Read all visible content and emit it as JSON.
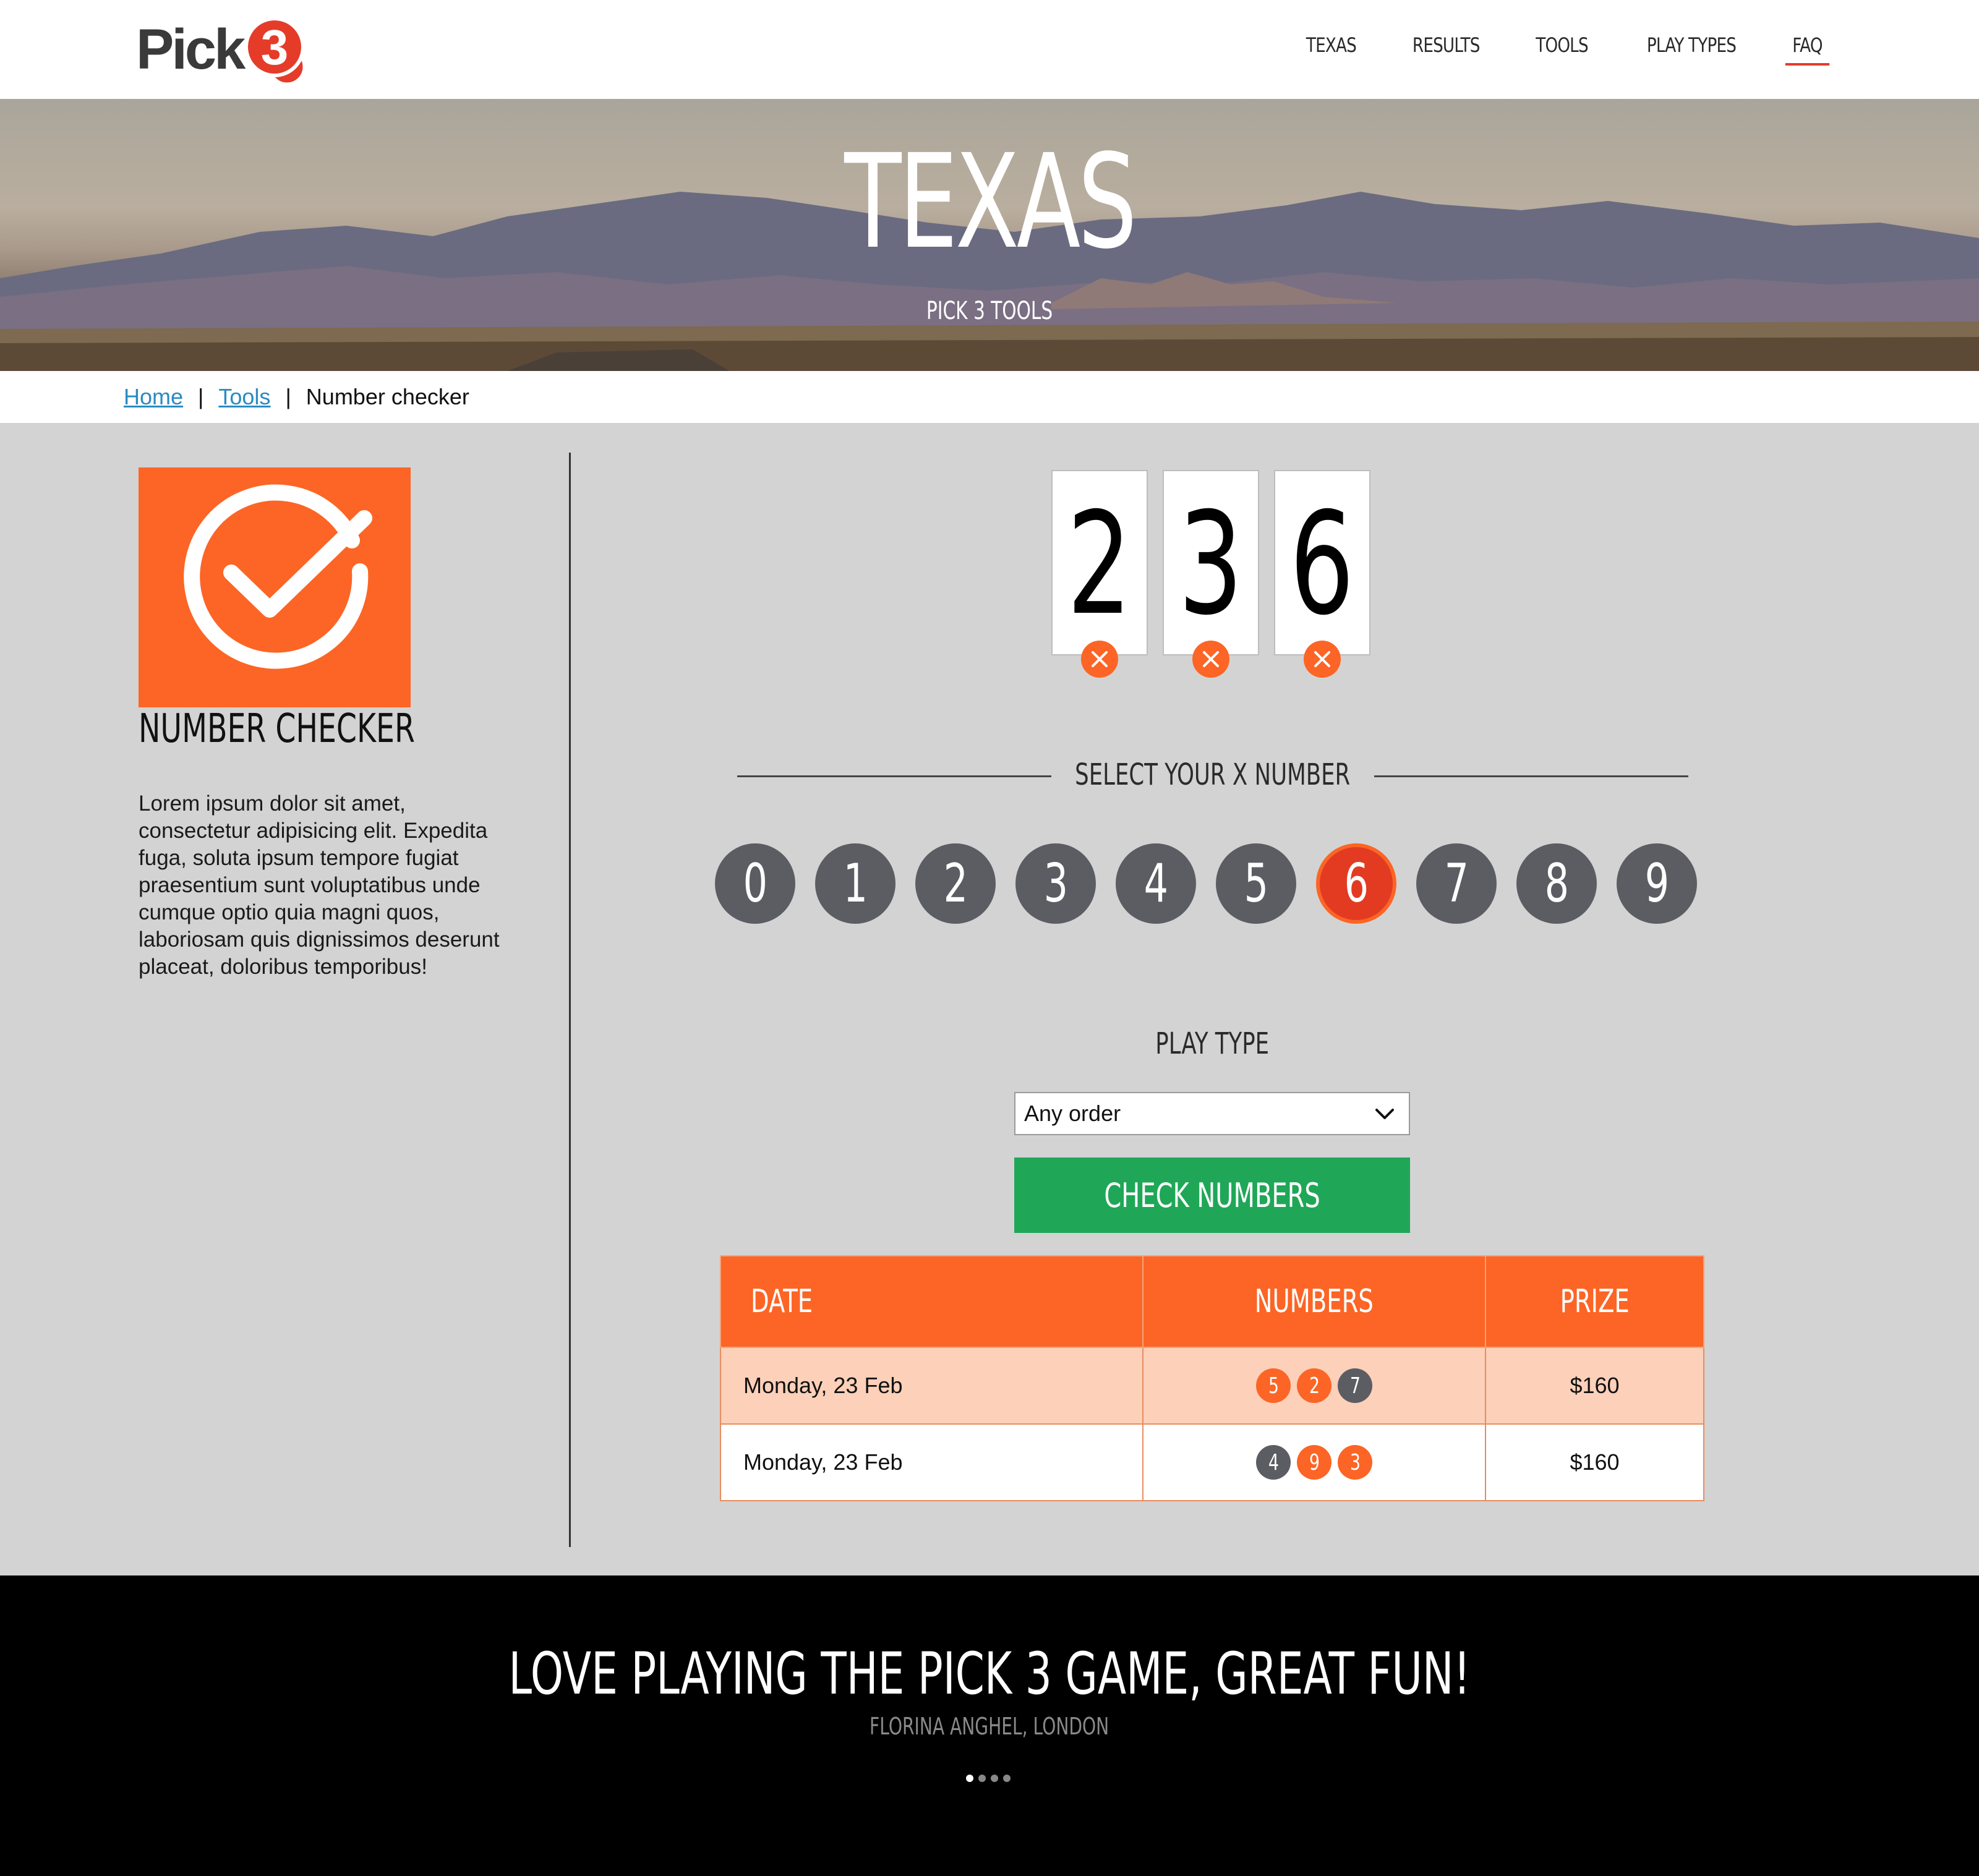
{
  "header": {
    "logo_text": "Pick",
    "logo_digit": "3",
    "nav": [
      {
        "label": "TEXAS",
        "active": false
      },
      {
        "label": "RESULTS",
        "active": false
      },
      {
        "label": "TOOLS",
        "active": false
      },
      {
        "label": "PLAY TYPES",
        "active": false
      },
      {
        "label": "FAQ",
        "active": true
      }
    ]
  },
  "hero": {
    "title": "TEXAS",
    "subtitle": "PICK 3 TOOLS"
  },
  "breadcrumb": {
    "home": "Home",
    "tools": "Tools",
    "separator": "|",
    "current": "Number checker"
  },
  "tool": {
    "icon": "check-circle-icon",
    "title": "NUMBER CHECKER",
    "description": "Lorem ipsum dolor sit amet, consectetur adipisicing elit. Expedita fuga, soluta ipsum tempore fugiat praesentium sunt voluptatibus unde cumque optio quia magni quos, laboriosam quis dignissimos deserunt placeat, doloribus temporibus!"
  },
  "selected_numbers": [
    "2",
    "3",
    "6"
  ],
  "x_number": {
    "heading": "SELECT YOUR X NUMBER",
    "options": [
      "0",
      "1",
      "2",
      "3",
      "4",
      "5",
      "6",
      "7",
      "8",
      "9"
    ],
    "selected": "6"
  },
  "play_type": {
    "label": "PLAY TYPE",
    "value": "Any order"
  },
  "check_button": "CHECK NUMBERS",
  "results": {
    "headers": [
      "DATE",
      "NUMBERS",
      "PRIZE"
    ],
    "rows": [
      {
        "date": "Monday, 23 Feb",
        "prize": "$160",
        "numbers": [
          {
            "n": "5",
            "match": true
          },
          {
            "n": "2",
            "match": true
          },
          {
            "n": "7",
            "match": false
          }
        ]
      },
      {
        "date": "Monday, 23 Feb",
        "prize": "$160",
        "numbers": [
          {
            "n": "4",
            "match": false
          },
          {
            "n": "9",
            "match": true
          },
          {
            "n": "3",
            "match": true
          }
        ]
      }
    ]
  },
  "testimonial": {
    "quote": "LOVE PLAYING THE PICK 3 GAME, GREAT FUN!",
    "author": "FLORINA ANGHEL, LONDON",
    "dots": 4,
    "active_dot": 0
  },
  "colors": {
    "accent": "#fc6525",
    "selected_ball": "#e23b22",
    "ball": "#5c5d63",
    "check_button": "#1fa757",
    "link": "#2a8bc0",
    "row_highlight": "#fdd0b9"
  }
}
